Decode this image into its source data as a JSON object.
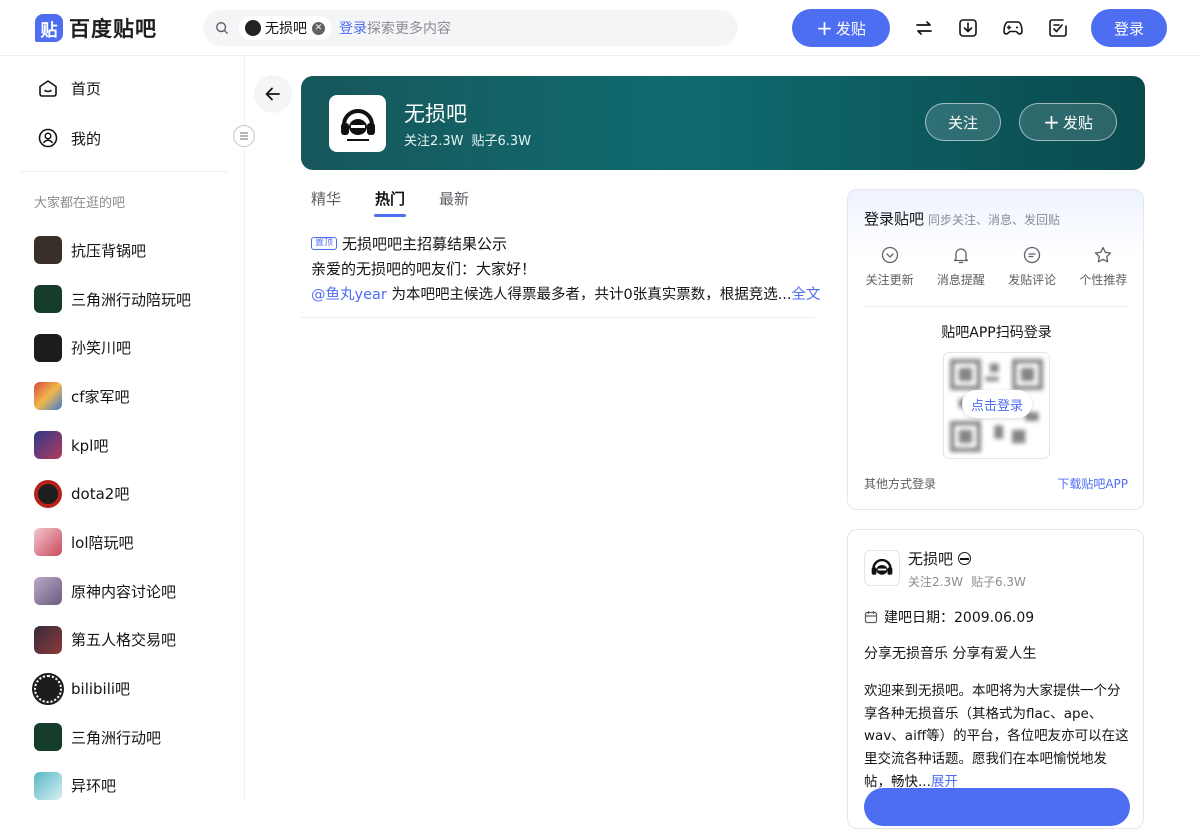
{
  "header": {
    "logo_char": "贴",
    "logo_text": "百度贴吧",
    "search": {
      "chip_label": "无损吧",
      "login_link": "登录",
      "placeholder_text": "探索更多内容"
    },
    "post_button": "发贴",
    "login_button": "登录",
    "icons": [
      "switch-icon",
      "download-icon",
      "gamepad-icon",
      "edit-note-icon"
    ]
  },
  "sidebar": {
    "nav": [
      {
        "label": "首页",
        "icon": "home-icon"
      },
      {
        "label": "我的",
        "icon": "user-icon"
      }
    ],
    "section_title": "大家都在逛的吧",
    "forums": [
      {
        "label": "抗压背锅吧",
        "color": "#3a2f28"
      },
      {
        "label": "三角洲行动陪玩吧",
        "color": "#143d2c"
      },
      {
        "label": "孙笑川吧",
        "color": "#1c1c1c"
      },
      {
        "label": "cf家军吧",
        "color": "#d6483f"
      },
      {
        "label": "kpl吧",
        "color": "#2d3a8c"
      },
      {
        "label": "dota2吧",
        "color": "#b2231b"
      },
      {
        "label": "lol陪玩吧",
        "color": "#c94a5e"
      },
      {
        "label": "原神内容讨论吧",
        "color": "#6c5a7e"
      },
      {
        "label": "第五人格交易吧",
        "color": "#3a2b3b"
      },
      {
        "label": "bilibili吧",
        "color": "#1c1c1c"
      },
      {
        "label": "三角洲行动吧",
        "color": "#143d2c"
      },
      {
        "label": "异环吧",
        "color": "#56b8c6"
      }
    ]
  },
  "forum": {
    "name": "无损吧",
    "followers_label": "关注2.3W",
    "posts_label": "贴子6.3W",
    "follow_button": "关注",
    "post_button": "发贴",
    "banner_color": "#0f6b6f"
  },
  "tabs": [
    {
      "label": "精华",
      "active": false
    },
    {
      "label": "热门",
      "active": true
    },
    {
      "label": "最新",
      "active": false
    }
  ],
  "post": {
    "pin_label": "置顶",
    "title": "无损吧吧主招募结果公示",
    "line2": "亲爱的无损吧的吧友们：大家好！",
    "mention": "@鱼丸year",
    "line3": " 为本吧吧主候选人得票最多者，共计0张真实票数，根据竞选...",
    "more_link": "全文"
  },
  "login_card": {
    "title": "登录贴吧",
    "subtitle": "同步关注、消息、发回贴",
    "features": [
      {
        "label": "关注更新",
        "icon": "follow-update-icon"
      },
      {
        "label": "消息提醒",
        "icon": "bell-icon"
      },
      {
        "label": "发贴评论",
        "icon": "comment-icon"
      },
      {
        "label": "个性推荐",
        "icon": "star-icon"
      }
    ],
    "qr_title": "贴吧APP扫码登录",
    "qr_button": "点击登录",
    "other_login": "其他方式登录",
    "download_app": "下载贴吧APP"
  },
  "info_card": {
    "name": "无损吧",
    "followers_label": "关注2.3W",
    "posts_label": "贴子6.3W",
    "created_label": "建吧日期：2009.06.09",
    "slogan": "分享无损音乐 分享有爱人生",
    "description": "欢迎来到无损吧。本吧将为大家提供一个分享各种无损音乐（其格式为flac、ape、wav、aiff等）的平台，各位吧友亦可以在这里交流各种话题。愿我们在本吧愉悦地发帖，畅快...",
    "expand_link": "展开"
  },
  "accent_color": "#4e6ef2"
}
